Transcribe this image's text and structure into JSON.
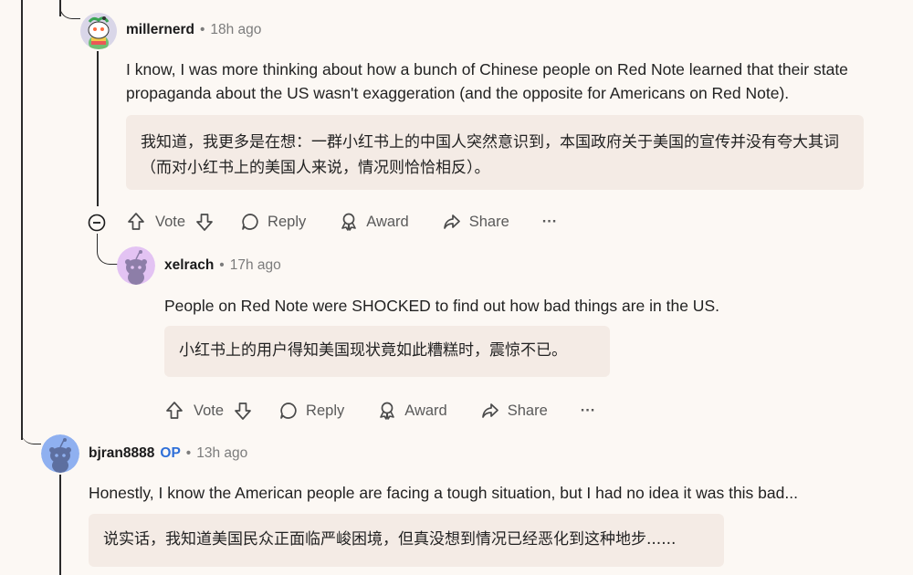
{
  "comments": [
    {
      "username": "millernerd",
      "time": "18h ago",
      "body": "I know, I was more thinking about how a bunch of Chinese people on Red Note learned that their state propaganda about the US wasn't exaggeration (and the opposite for Americans on Red Note).",
      "translation": "我知道，我更多是在想：一群小红书上的中国人突然意识到，本国政府关于美国的宣传并没有夸大其词（而对小红书上的美国人来说，情况则恰恰相反）。"
    },
    {
      "username": "xelrach",
      "time": "17h ago",
      "body": "People on Red Note were SHOCKED to find out how bad things are in the US.",
      "translation": "小红书上的用户得知美国现状竟如此糟糕时，震惊不已。"
    },
    {
      "username": "bjran8888",
      "op_badge": "OP",
      "time": "13h ago",
      "body": "Honestly, I know the American people are facing a tough situation, but I had no idea it was this bad...",
      "translation": "说实话，我知道美国民众正面临严峻困境，但真没想到情况已经恶化到这种地步......"
    }
  ],
  "actions": {
    "vote": "Vote",
    "reply": "Reply",
    "award": "Award",
    "share": "Share",
    "more": "···"
  },
  "separator": "•",
  "colors": {
    "background": "#fcf8f4",
    "translation_bg": "#f4ebe5",
    "op_blue": "#2f6fd8",
    "avatar_purple": "#e3c3f3",
    "avatar_blue": "#8fb0f0"
  }
}
